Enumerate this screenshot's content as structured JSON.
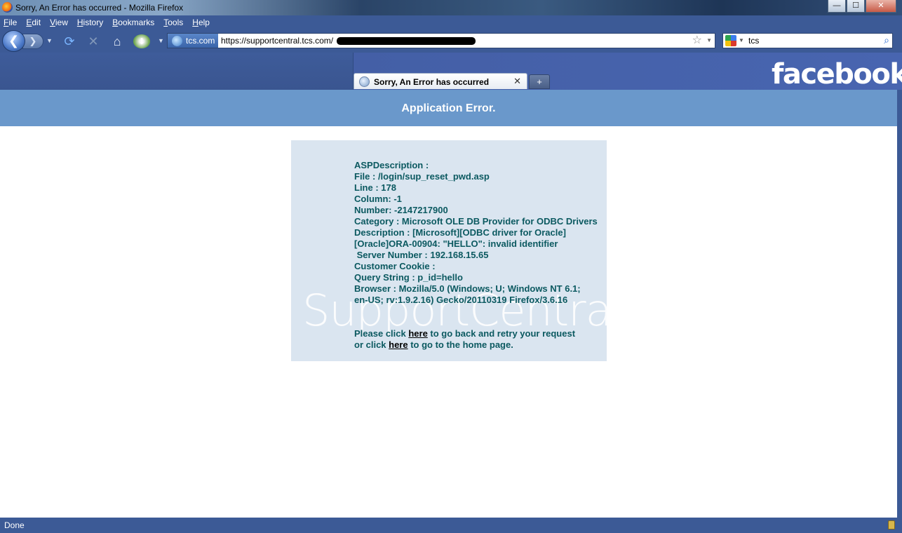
{
  "window": {
    "title": "Sorry, An Error has occurred - Mozilla Firefox",
    "buttons": {
      "minimize": "—",
      "maximize": "☐",
      "close": "✕"
    }
  },
  "menu": [
    "File",
    "Edit",
    "View",
    "History",
    "Bookmarks",
    "Tools",
    "Help"
  ],
  "navbar": {
    "back_glyph": "❮",
    "forward_glyph": "❯",
    "identity_label": "tcs.com",
    "url": "https://supportcentral.tcs.com/",
    "search_value": "tcs"
  },
  "tabs": [
    {
      "label": "Sorry, An Error has occurred",
      "active": true
    }
  ],
  "newtab_label": "+",
  "brand_text": "facebook",
  "page": {
    "header": "Application Error.",
    "watermark": "SupportCentral",
    "error_lines": [
      "ASPDescription :",
      "File : /login/sup_reset_pwd.asp",
      "Line : 178",
      "Column: -1",
      "Number: -2147217900",
      "Category : Microsoft OLE DB Provider for ODBC Drivers",
      "Description : [Microsoft][ODBC driver for Oracle] [Oracle]ORA-00904: \"HELLO\": invalid identifier",
      " Server Number : 192.168.15.65",
      "Customer Cookie :",
      "Query String : p_id=hello",
      "Browser : Mozilla/5.0 (Windows; U; Windows NT 6.1; en-US; rv:1.9.2.16) Gecko/20110319 Firefox/3.6.16"
    ],
    "retry": {
      "line1_prefix": "Please click ",
      "line1_link": "here",
      "line1_suffix": " to go back and retry your request",
      "line2_prefix": "or click ",
      "line2_link": "here",
      "line2_suffix": " to go to the home page."
    }
  },
  "status": {
    "text": "Done"
  },
  "colors": {
    "header_bg": "#6a98cb",
    "error_box_bg": "#dae5f0",
    "error_text": "#0b5960",
    "chrome_blue": "#3c5a96"
  }
}
